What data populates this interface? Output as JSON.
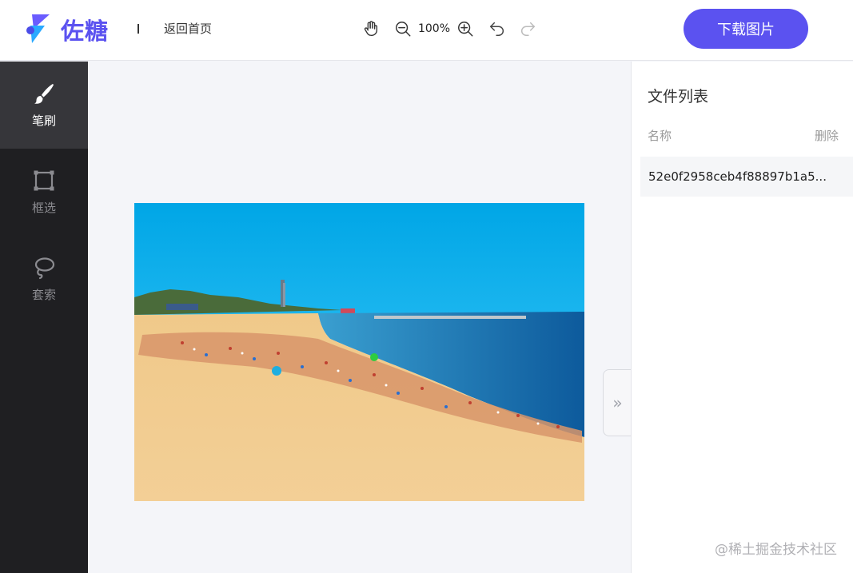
{
  "header": {
    "brand": "佐糖",
    "home_link": "返回首页",
    "zoom": "100%",
    "download_label": "下载图片"
  },
  "toolbar": {
    "icons": [
      "hand-icon",
      "zoom-out-icon",
      "zoom-in-icon",
      "undo-icon",
      "redo-icon"
    ]
  },
  "sidebar": {
    "items": [
      {
        "label": "笔刷",
        "icon": "brush-icon",
        "active": true
      },
      {
        "label": "框选",
        "icon": "rectangle-select-icon",
        "active": false
      },
      {
        "label": "套索",
        "icon": "lasso-icon",
        "active": false
      }
    ]
  },
  "file_panel": {
    "title": "文件列表",
    "col_name": "名称",
    "col_delete": "删除",
    "files": [
      {
        "name": "52e0f2958ceb4f88897b1a5..."
      }
    ]
  },
  "watermark": "@稀土掘金技术社区",
  "colors": {
    "accent": "#5b52f0",
    "sidebar_bg": "#1f1f22",
    "sidebar_active": "#36363a",
    "canvas_bg": "#f4f5f9"
  }
}
